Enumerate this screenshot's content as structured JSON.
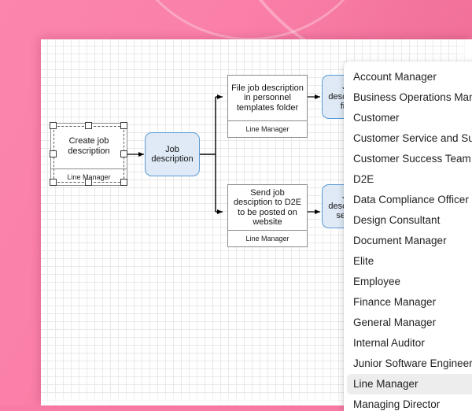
{
  "canvas": {
    "nodes": [
      {
        "id": "create-job-description",
        "type": "task",
        "text": "Create job description",
        "lane": "Line Manager",
        "selected": true
      },
      {
        "id": "job-description",
        "type": "data",
        "text": "Job description"
      },
      {
        "id": "file-job-description",
        "type": "task",
        "text": "File job description in personnel templates folder",
        "lane": "Line Manager"
      },
      {
        "id": "send-job-description",
        "type": "task",
        "text": "Send job desciption to D2E to be posted on website",
        "lane": "Line Manager"
      },
      {
        "id": "job-description-filled",
        "type": "data",
        "text": "Job description filled"
      },
      {
        "id": "job-description-sent",
        "type": "data",
        "text": "Job description sent to"
      }
    ]
  },
  "dropdown": {
    "selected": "Line Manager",
    "options": [
      "Account Manager",
      "Business Operations Manager",
      "Customer",
      "Customer Service and Support",
      "Customer Success Team",
      "D2E",
      "Data Compliance Officer",
      "Design Consultant",
      "Document Manager",
      "Elite",
      "Employee",
      "Finance Manager",
      "General Manager",
      "Internal Auditor",
      "Junior Software Engineer",
      "Line Manager",
      "Managing Director"
    ]
  },
  "colors": {
    "backdrop": "#fa80a9",
    "data_fill": "#dfeaf6",
    "data_stroke": "#5b9bd5",
    "task_stroke": "#8c8c8c",
    "highlight": "#ededed"
  }
}
